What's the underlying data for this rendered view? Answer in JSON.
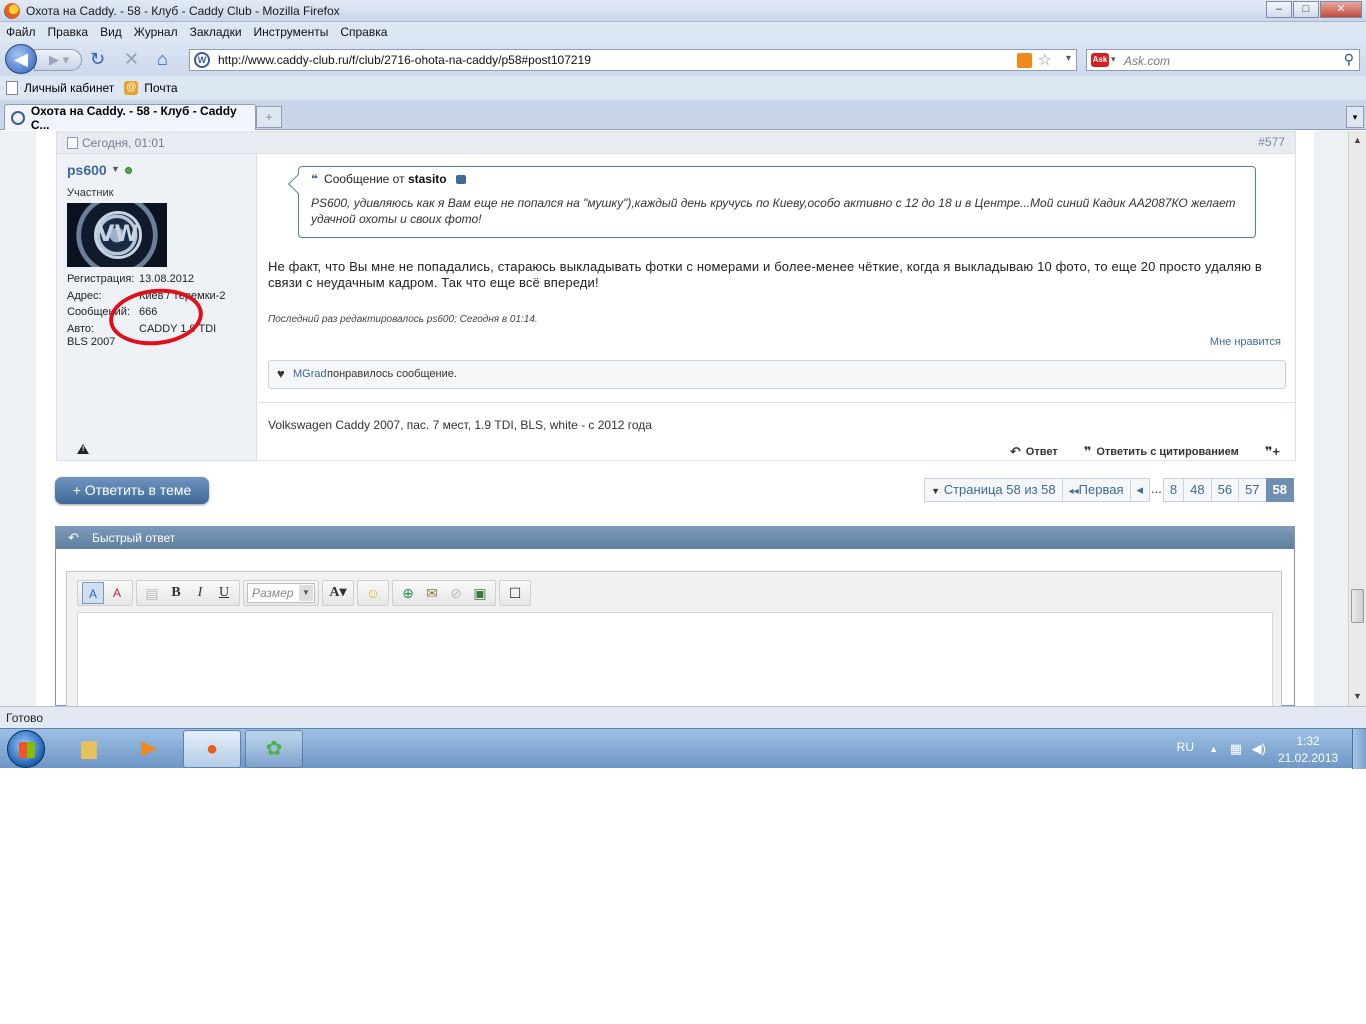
{
  "window": {
    "title": "Охота на Caddy. - 58 - Клуб - Caddy Club - Mozilla Firefox",
    "min": "‒",
    "max": "□",
    "close": "✕"
  },
  "menu": [
    "Файл",
    "Правка",
    "Вид",
    "Журнал",
    "Закладки",
    "Инструменты",
    "Справка"
  ],
  "nav": {
    "url": "http://www.caddy-club.ru/f/club/2716-ohota-na-caddy/p58#post107219",
    "search_placeholder": "Ask.com"
  },
  "bookmarks": [
    "Личный кабинет",
    "Почта"
  ],
  "tab": {
    "title": "Охота на Caddy. - 58 - Клуб - Caddy C..."
  },
  "post": {
    "date": "Сегодня, 01:01",
    "number": "#577",
    "user": {
      "name": "ps600",
      "rank": "Участник",
      "registration_label": "Регистрация:",
      "registration": "13.08.2012",
      "address_label": "Адрес:",
      "address": "Киев / Теремки-2",
      "messages_label": "Сообщений:",
      "messages": "666",
      "auto_label": "Авто:",
      "auto": "CADDY 1,9 TDI",
      "auto2": "BLS 2007"
    },
    "quote": {
      "prefix": "Сообщение от",
      "author": "stasito",
      "text": "PS600, удивляюсь как я Вам еще не попался на \"мушку\"),каждый день кручусь по Киеву,особо активно с 12 до 18 и в Центре...Мой синий Кадик АА2087КО желает удачной охоты и своих фото!"
    },
    "message": "Не факт, что Вы мне не попадались, стараюсь выкладывать фотки с номерами и более-менее чёткие, когда я выкладываю 10 фото, то еще 20 просто удаляю в связи с неудачным кадром. Так что еще всё впереди!",
    "edited": "Последний раз редактировалось ps600; Сегодня в 01:14.",
    "like_link": "Мне нравится",
    "liked_by": "MGrad",
    "liked_text": "понравилось сообщение.",
    "signature": "Volkswagen Caddy 2007, пас. 7 мест, 1.9 TDI, BLS, white - с 2012 года",
    "actions": {
      "reply": "Ответ",
      "quote_reply": "Ответить с цитированием"
    }
  },
  "reply_button": "+ Ответить в теме",
  "pagination": {
    "label": "Страница 58 из 58",
    "first": "Первая",
    "prev": "◂",
    "dots": "...",
    "pages": [
      "8",
      "48",
      "56",
      "57"
    ],
    "current": "58"
  },
  "quick_reply": {
    "title": "Быстрый ответ",
    "size_placeholder": "Размер"
  },
  "status": "Готово",
  "tray": {
    "lang": "RU",
    "time": "1:32",
    "date": "21.02.2013"
  }
}
